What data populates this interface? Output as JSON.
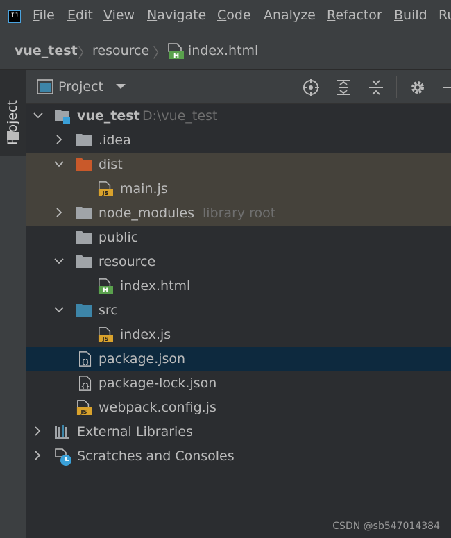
{
  "menubar": {
    "items": [
      {
        "mnemonic": "F",
        "rest": "ile"
      },
      {
        "mnemonic": "E",
        "rest": "dit"
      },
      {
        "mnemonic": "V",
        "rest": "iew"
      },
      {
        "mnemonic": "N",
        "rest": "avigate"
      },
      {
        "mnemonic": "C",
        "rest": "ode"
      },
      {
        "mnemonic": "",
        "rest": "Analyze"
      },
      {
        "mnemonic": "R",
        "rest": "efactor"
      },
      {
        "mnemonic": "B",
        "rest": "uild"
      },
      {
        "mnemonic": "",
        "rest": "Ru"
      }
    ]
  },
  "breadcrumb": {
    "items": [
      "vue_test",
      "resource",
      "index.html"
    ]
  },
  "toolwindow": {
    "label": "Project"
  },
  "panel": {
    "title": "Project"
  },
  "tree": {
    "rows": [
      {
        "label": "vue_test",
        "hint": "D:\\vue_test"
      },
      {
        "label": ".idea"
      },
      {
        "label": "dist"
      },
      {
        "label": "main.js"
      },
      {
        "label": "node_modules",
        "hint": "library root"
      },
      {
        "label": "public"
      },
      {
        "label": "resource"
      },
      {
        "label": "index.html"
      },
      {
        "label": "src"
      },
      {
        "label": "index.js"
      },
      {
        "label": "package.json"
      },
      {
        "label": "package-lock.json"
      },
      {
        "label": "webpack.config.js"
      },
      {
        "label": "External Libraries"
      },
      {
        "label": "Scratches and Consoles"
      }
    ]
  },
  "icons": {
    "js_badge": "JS",
    "html_badge": "H",
    "app_badge": "IJ"
  },
  "colors": {
    "excluded_bg": "#45423b",
    "selected_bg": "#0d293e",
    "excluded_folder": "#c9592a",
    "source_folder": "#3d85a8",
    "html_green": "#5aa14d",
    "js_yellow": "#d9a22c"
  },
  "watermark": "CSDN @sb547014384"
}
